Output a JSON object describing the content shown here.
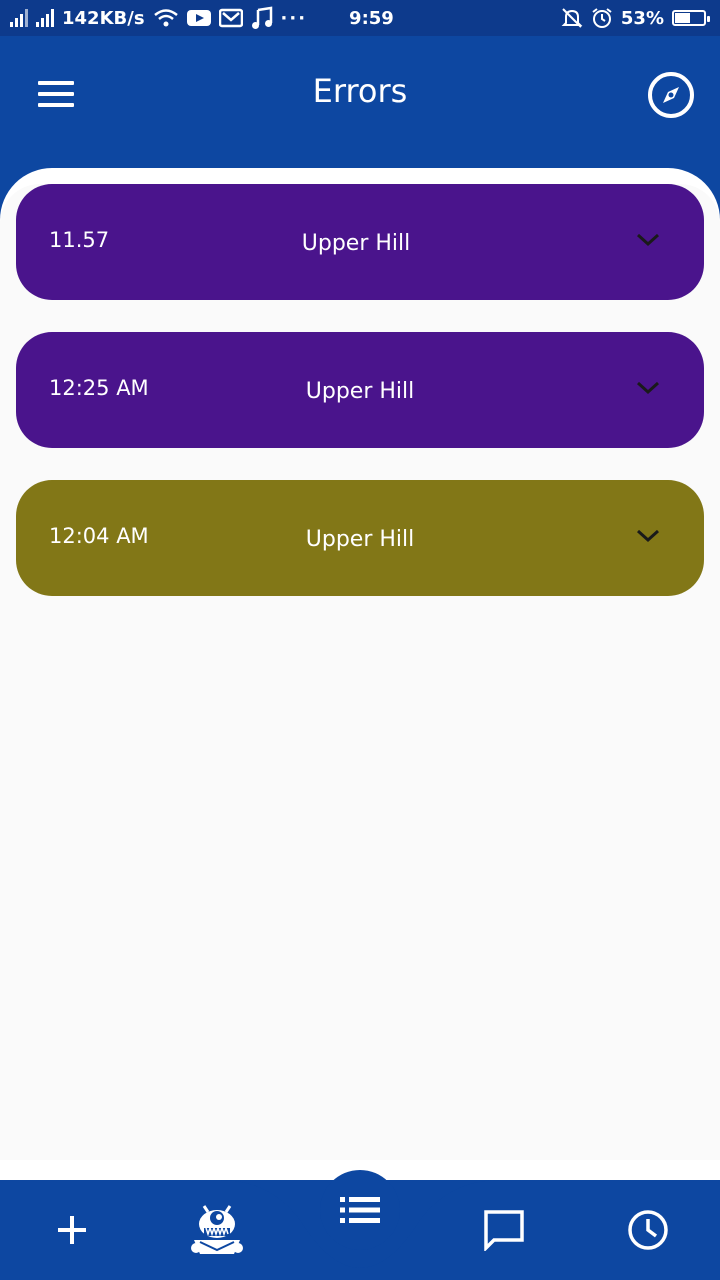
{
  "status_bar": {
    "net_speed": "142KB/s",
    "time": "9:59",
    "battery_percent": "53%",
    "battery_level": 0.53,
    "icons": [
      "signal-icon",
      "signal-icon",
      "wifi-icon",
      "youtube-icon",
      "gmail-icon",
      "music-icon",
      "more-dots-icon",
      "mute-bell-icon",
      "alarm-icon",
      "battery-icon"
    ]
  },
  "header": {
    "title": "Errors",
    "menu_icon": "hamburger-menu-icon",
    "action_icon": "compass-icon"
  },
  "colors": {
    "primary": "#0d47a1",
    "card_purple": "#4a148c",
    "card_olive": "#827717",
    "background": "#fafafa"
  },
  "errors": [
    {
      "time": "11.57",
      "location": "Upper Hill",
      "color": "#4a148c"
    },
    {
      "time": "12:25 AM",
      "location": "Upper Hill",
      "color": "#4a148c"
    },
    {
      "time": "12:04 AM",
      "location": "Upper Hill",
      "color": "#827717"
    }
  ],
  "bottom_nav": {
    "items": [
      "add-icon",
      "monster-mascot-icon",
      "list-icon",
      "chat-bubble-icon",
      "clock-icon"
    ],
    "active": "list-icon"
  }
}
